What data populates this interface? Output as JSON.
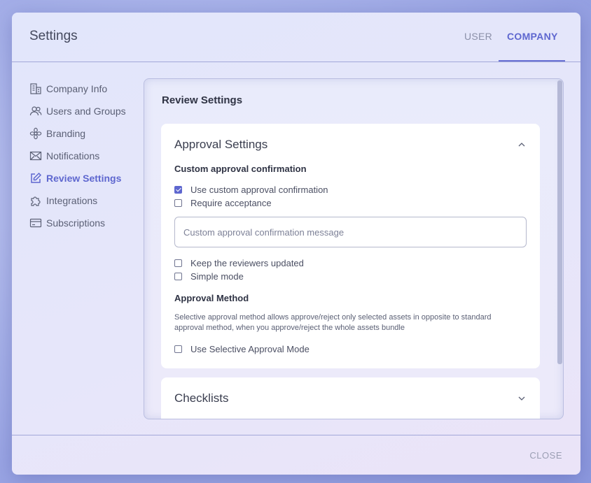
{
  "header": {
    "title": "Settings",
    "tabs": [
      {
        "label": "USER",
        "active": false
      },
      {
        "label": "COMPANY",
        "active": true
      }
    ]
  },
  "sidebar": {
    "items": [
      {
        "label": "Company Info",
        "icon": "building-icon",
        "active": false
      },
      {
        "label": "Users and Groups",
        "icon": "users-icon",
        "active": false
      },
      {
        "label": "Branding",
        "icon": "flower-icon",
        "active": false
      },
      {
        "label": "Notifications",
        "icon": "envelope-icon",
        "active": false
      },
      {
        "label": "Review Settings",
        "icon": "edit-icon",
        "active": true
      },
      {
        "label": "Integrations",
        "icon": "puzzle-icon",
        "active": false
      },
      {
        "label": "Subscriptions",
        "icon": "credit-card-icon",
        "active": false
      }
    ]
  },
  "main": {
    "section_title": "Review Settings",
    "approval_card": {
      "title": "Approval Settings",
      "expanded": true,
      "custom_confirmation_heading": "Custom approval confirmation",
      "options": [
        {
          "label": "Use custom approval confirmation",
          "checked": true
        },
        {
          "label": "Require acceptance",
          "checked": false
        }
      ],
      "message_placeholder": "Custom approval confirmation message",
      "message_value": "",
      "more_options": [
        {
          "label": "Keep the reviewers updated",
          "checked": false
        },
        {
          "label": "Simple mode",
          "checked": false
        }
      ],
      "method_heading": "Approval Method",
      "method_description": "Selective approval method allows approve/reject only selected assets in opposite to standard approval method, when you approve/reject the whole assets bundle",
      "selective_option": {
        "label": "Use Selective Approval Mode",
        "checked": false
      }
    },
    "checklists_card": {
      "title": "Checklists",
      "expanded": false
    }
  },
  "footer": {
    "close_label": "CLOSE"
  },
  "colors": {
    "accent": "#5e67cf",
    "text": "#5b6075",
    "muted": "#9a9eb3"
  }
}
